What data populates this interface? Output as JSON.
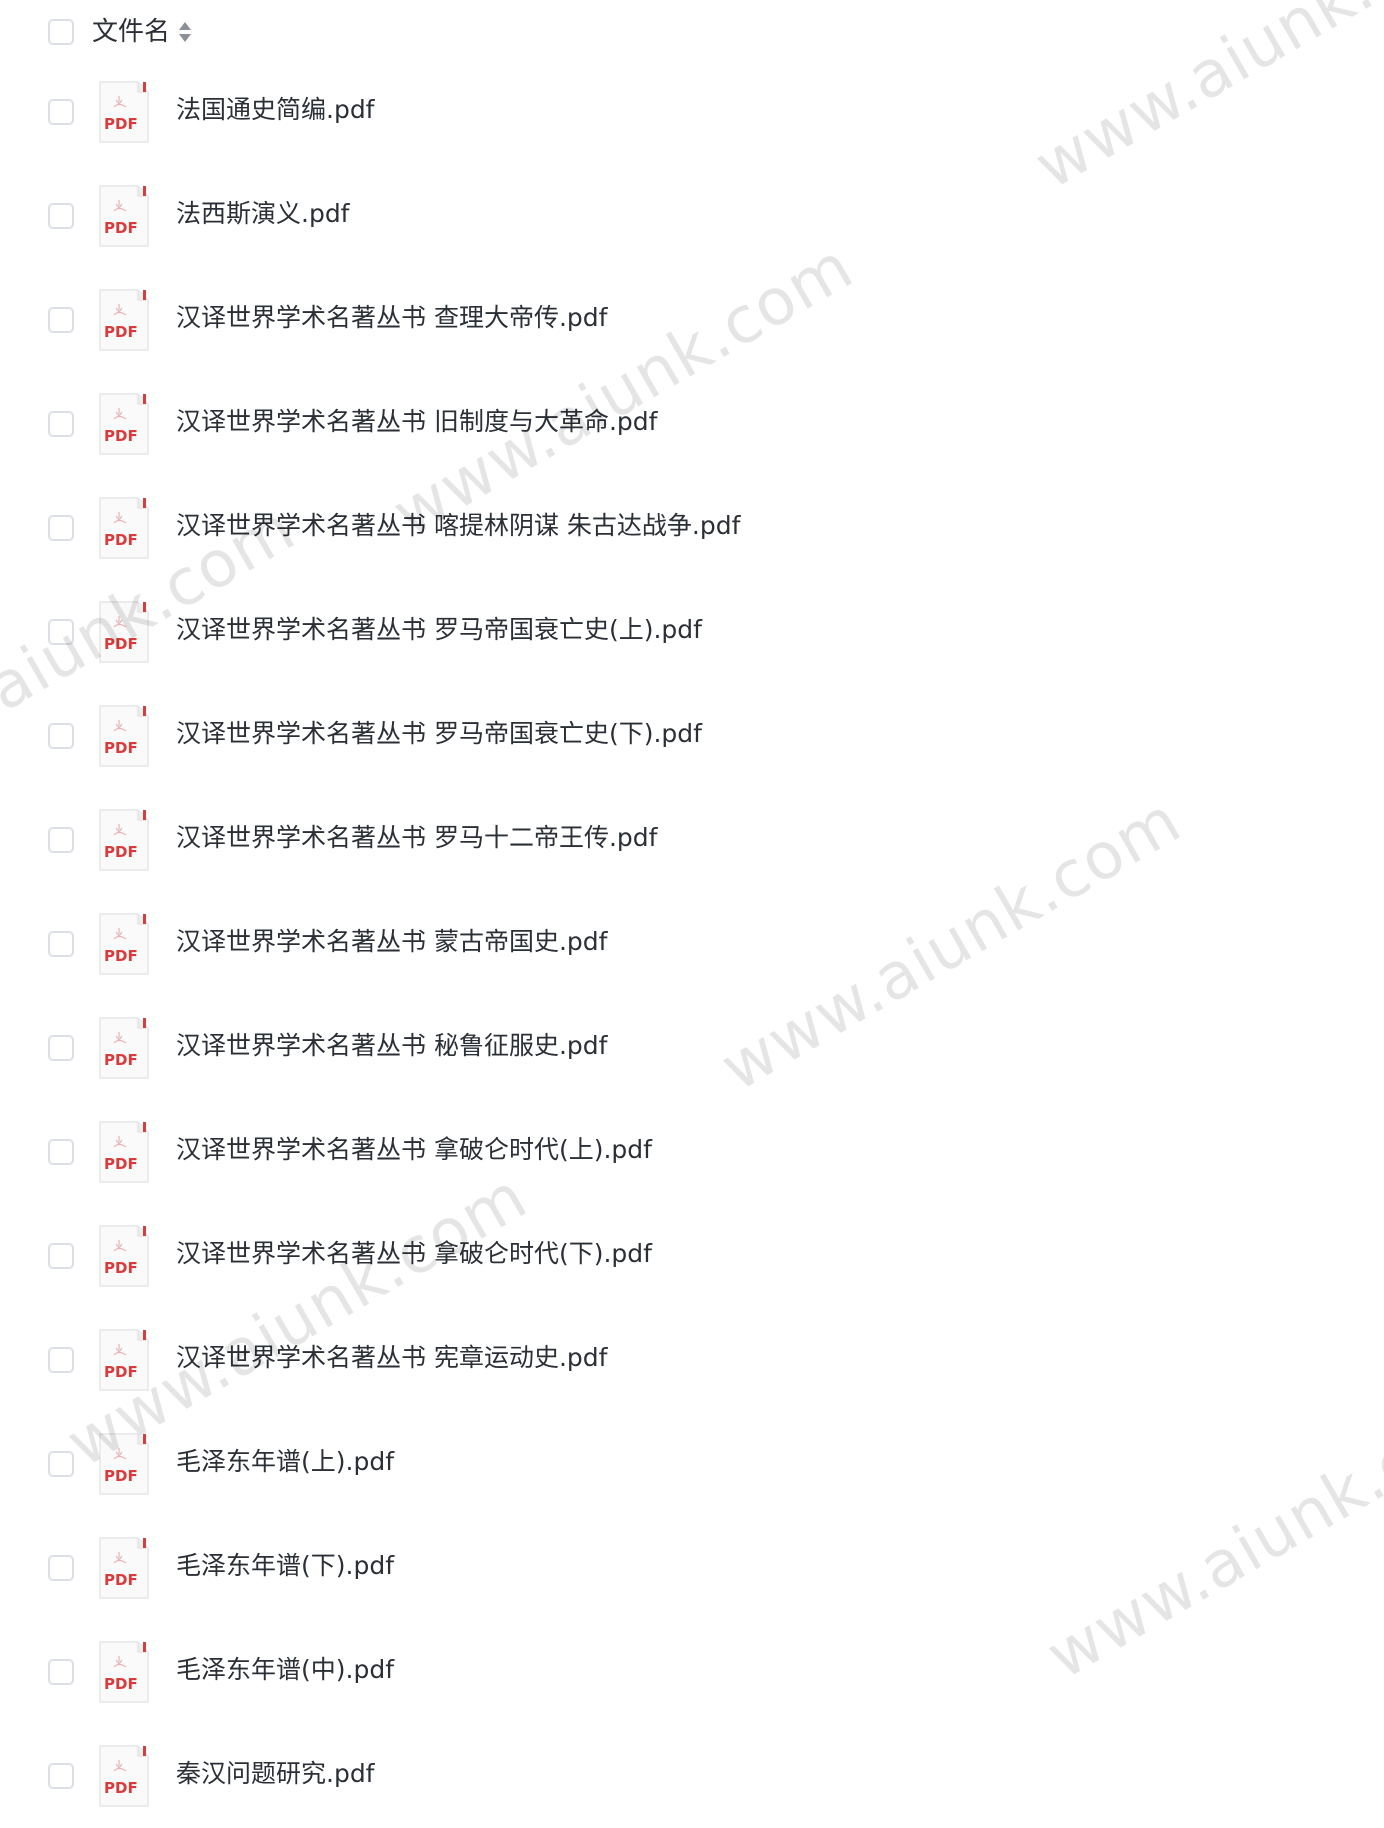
{
  "header": {
    "label": "文件名"
  },
  "icons": {
    "file_type_label": "PDF",
    "sort": "sort-icon",
    "file": "pdf-icon",
    "file_color": "#d73b3b"
  },
  "files": [
    {
      "name": "法国通史简编.pdf"
    },
    {
      "name": "法西斯演义.pdf"
    },
    {
      "name": "汉译世界学术名著丛书 查理大帝传.pdf"
    },
    {
      "name": "汉译世界学术名著丛书 旧制度与大革命.pdf"
    },
    {
      "name": "汉译世界学术名著丛书 喀提林阴谋 朱古达战争.pdf"
    },
    {
      "name": "汉译世界学术名著丛书 罗马帝国衰亡史(上).pdf"
    },
    {
      "name": "汉译世界学术名著丛书 罗马帝国衰亡史(下).pdf"
    },
    {
      "name": "汉译世界学术名著丛书 罗马十二帝王传.pdf"
    },
    {
      "name": "汉译世界学术名著丛书 蒙古帝国史.pdf"
    },
    {
      "name": "汉译世界学术名著丛书 秘鲁征服史.pdf"
    },
    {
      "name": "汉译世界学术名著丛书 拿破仑时代(上).pdf"
    },
    {
      "name": "汉译世界学术名著丛书 拿破仑时代(下).pdf"
    },
    {
      "name": "汉译世界学术名著丛书 宪章运动史.pdf"
    },
    {
      "name": "毛泽东年谱(上).pdf"
    },
    {
      "name": "毛泽东年谱(下).pdf"
    },
    {
      "name": "毛泽东年谱(中).pdf"
    },
    {
      "name": "秦汉问题研究.pdf"
    }
  ],
  "watermark": {
    "text": "www.aiunk.com"
  }
}
